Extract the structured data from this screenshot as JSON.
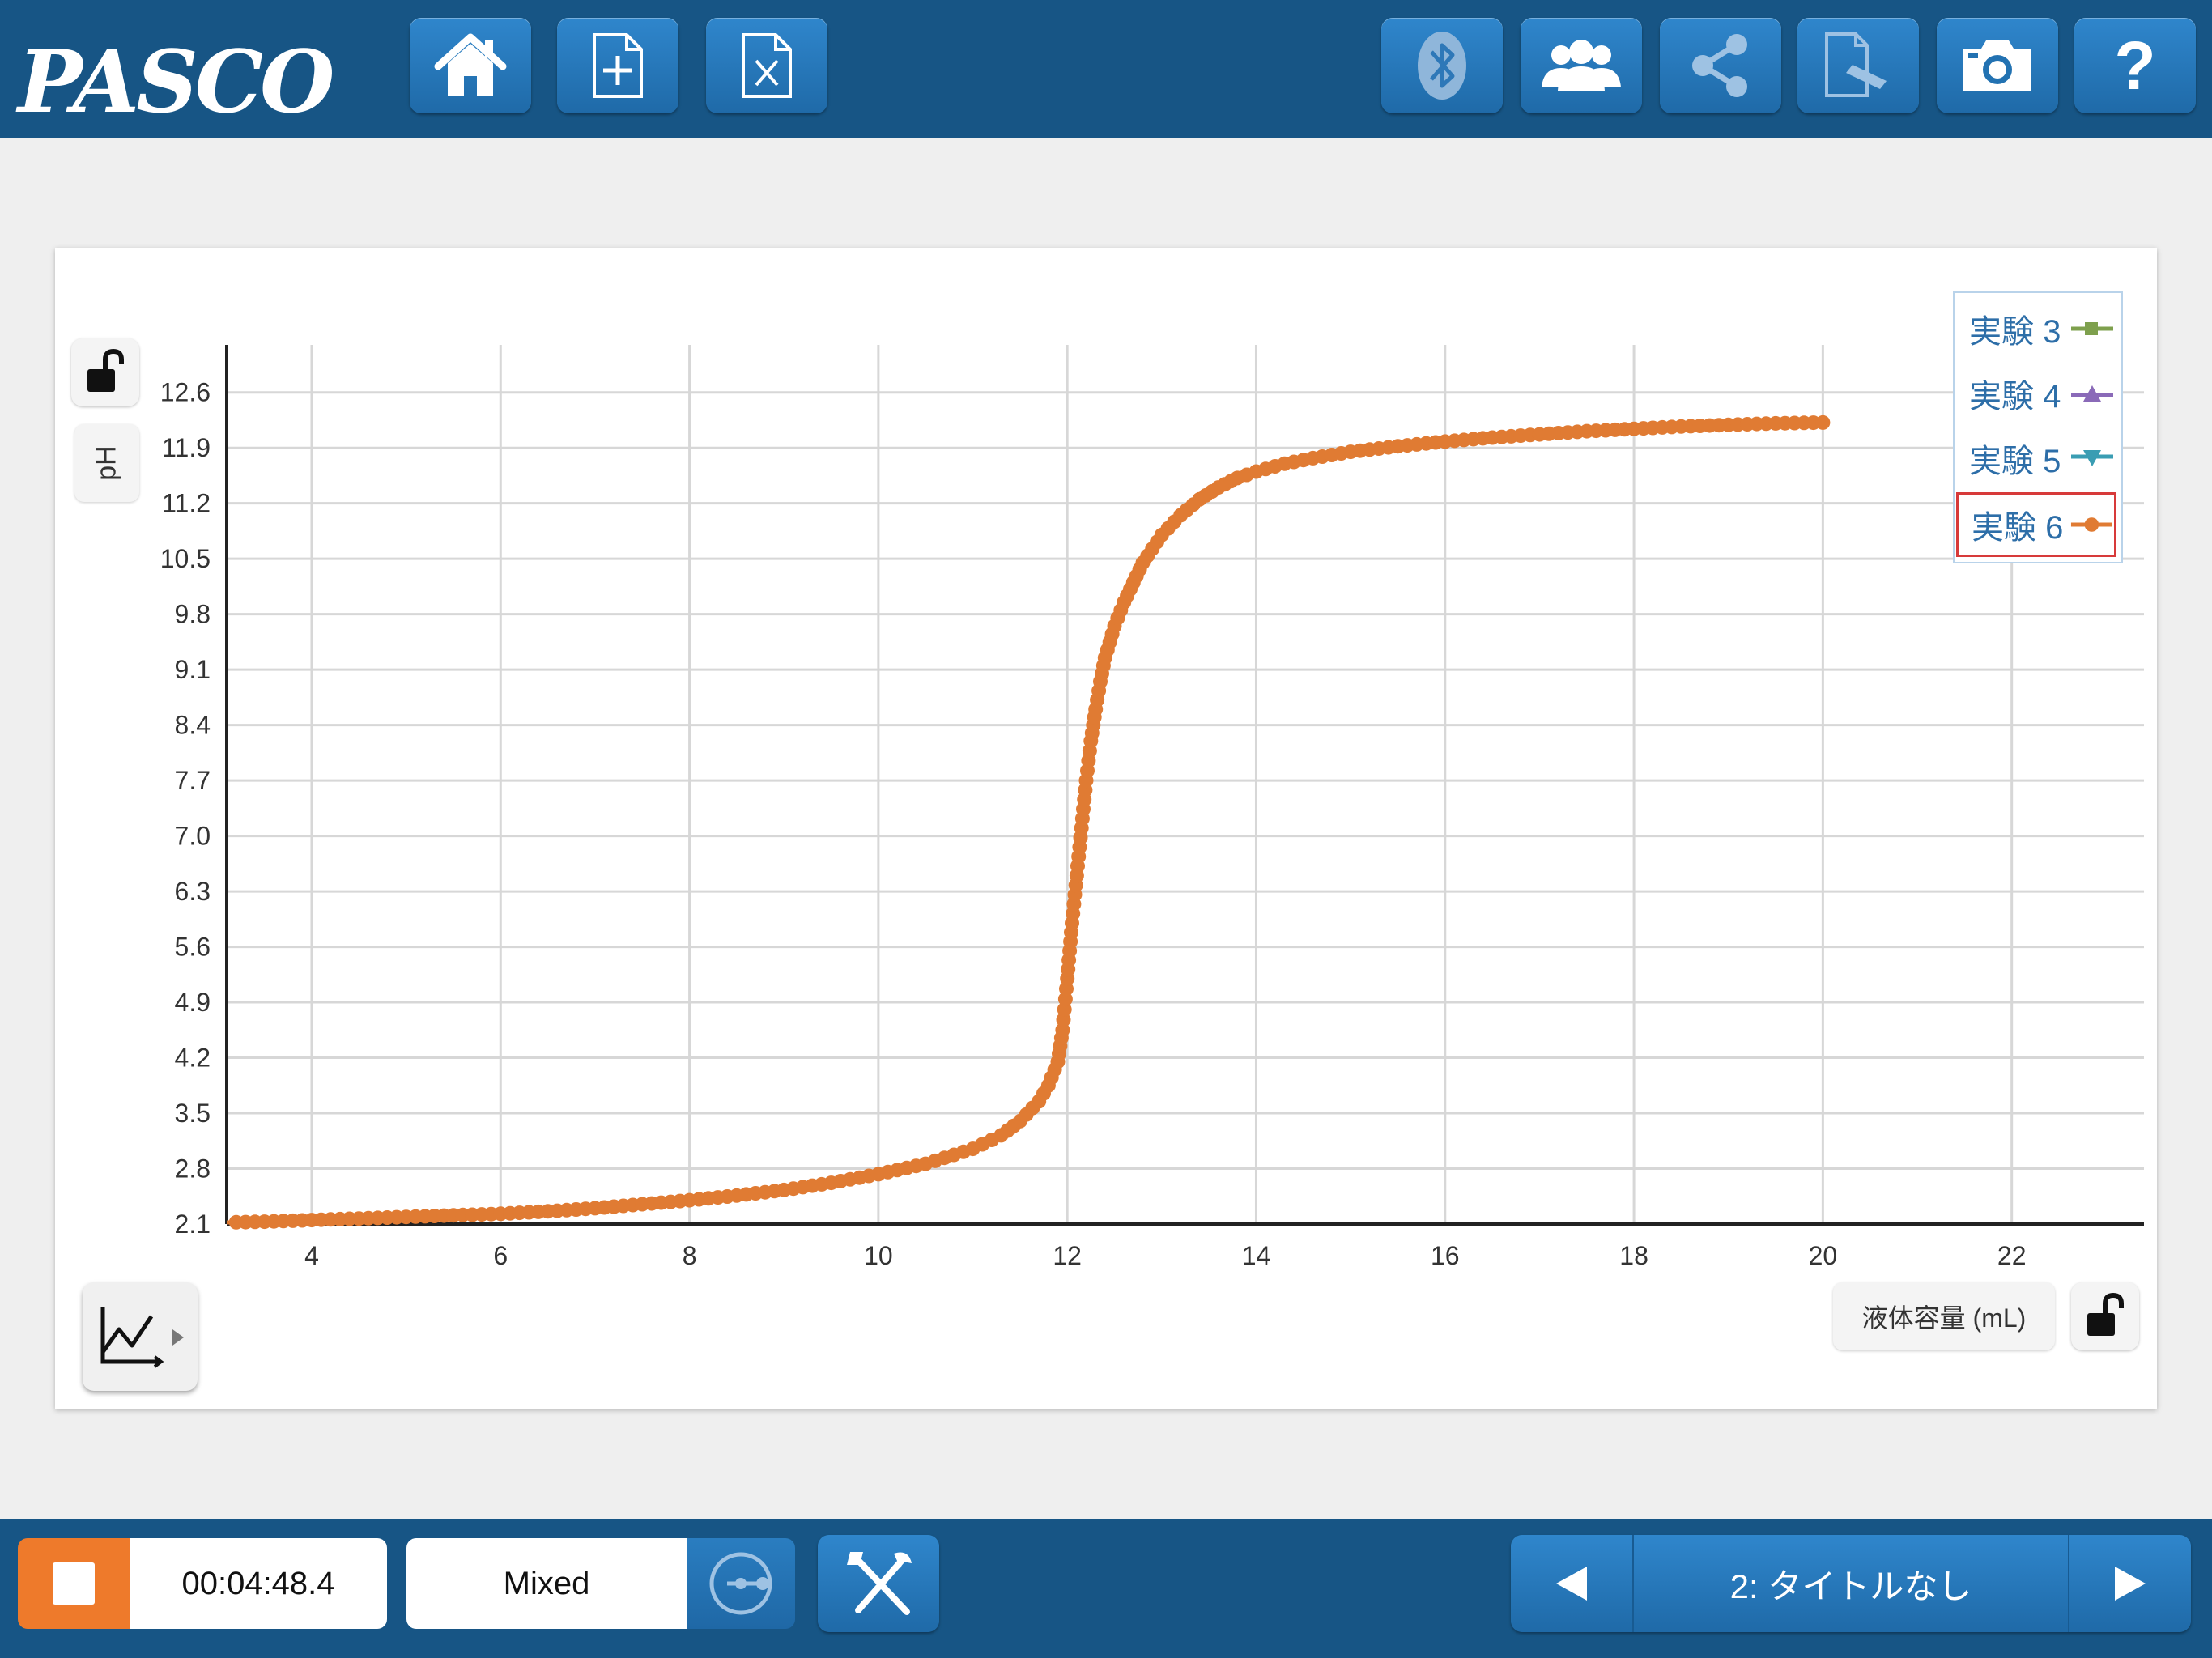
{
  "app": {
    "logo_text": "PASCO"
  },
  "toolbar": {
    "left_icons": [
      "home-icon",
      "new-file-icon",
      "close-file-icon"
    ],
    "right_icons": [
      "bluetooth-icon",
      "group-icon",
      "share-icon",
      "journal-icon",
      "camera-icon",
      "help-icon"
    ],
    "help_label": "?"
  },
  "graph": {
    "y_axis_label": "pH",
    "x_axis_label": "液体容量 (mL)"
  },
  "legend": {
    "items": [
      {
        "label": "実験 3",
        "color": "#7ea04d",
        "marker": "square",
        "selected": false
      },
      {
        "label": "実験 4",
        "color": "#8a6ab8",
        "marker": "triangle-up",
        "selected": false
      },
      {
        "label": "実験 5",
        "color": "#3a9db3",
        "marker": "triangle-down",
        "selected": false
      },
      {
        "label": "実験 6",
        "color": "#e07b33",
        "marker": "circle",
        "selected": true
      }
    ]
  },
  "chart_data": {
    "type": "line",
    "xlim": [
      3.1,
      23.4
    ],
    "ylim": [
      2.1,
      13.2
    ],
    "x_ticks": [
      4,
      6,
      8,
      10,
      12,
      14,
      16,
      18,
      20,
      22
    ],
    "y_ticks": [
      2.1,
      2.8,
      3.5,
      4.2,
      4.9,
      5.6,
      6.3,
      7.0,
      7.7,
      8.4,
      9.1,
      9.8,
      10.5,
      11.2,
      11.9,
      12.6
    ],
    "x_tick_labels": [
      "4",
      "6",
      "8",
      "10",
      "12",
      "14",
      "16",
      "18",
      "20",
      "22"
    ],
    "y_tick_labels": [
      "2.1",
      "2.8",
      "3.5",
      "4.2",
      "4.9",
      "5.6",
      "6.3",
      "7.0",
      "7.7",
      "8.4",
      "9.1",
      "9.8",
      "10.5",
      "11.2",
      "11.9",
      "12.6"
    ],
    "grid": true,
    "legend_position": "top-right",
    "series": [
      {
        "name": "実験 6",
        "color": "#e07b33",
        "x": [
          3.1,
          3.5,
          4.0,
          4.5,
          5.0,
          5.5,
          6.0,
          6.5,
          7.0,
          7.5,
          8.0,
          8.5,
          9.0,
          9.5,
          10.0,
          10.5,
          11.0,
          11.3,
          11.5,
          11.7,
          11.8,
          11.9,
          11.95,
          12.0,
          12.05,
          12.1,
          12.15,
          12.2,
          12.25,
          12.3,
          12.35,
          12.4,
          12.5,
          12.6,
          12.7,
          12.8,
          13.0,
          13.2,
          13.4,
          13.6,
          13.8,
          14.0,
          14.3,
          14.6,
          15.0,
          15.5,
          16.0,
          16.5,
          17.0,
          17.5,
          18.0,
          18.5,
          19.0,
          19.5,
          20.0
        ],
        "y": [
          2.12,
          2.13,
          2.15,
          2.17,
          2.19,
          2.21,
          2.23,
          2.26,
          2.3,
          2.35,
          2.4,
          2.46,
          2.53,
          2.62,
          2.73,
          2.86,
          3.05,
          3.22,
          3.4,
          3.65,
          3.85,
          4.15,
          4.55,
          5.2,
          5.9,
          6.5,
          7.1,
          7.7,
          8.2,
          8.6,
          8.95,
          9.25,
          9.65,
          9.95,
          10.2,
          10.45,
          10.8,
          11.05,
          11.25,
          11.4,
          11.52,
          11.6,
          11.7,
          11.77,
          11.85,
          11.92,
          11.98,
          12.03,
          12.07,
          12.11,
          12.14,
          12.17,
          12.19,
          12.21,
          12.22
        ]
      }
    ]
  },
  "bottom": {
    "timer": "00:04:48.4",
    "mode": "Mixed",
    "page_title": "2: タイトルなし"
  }
}
